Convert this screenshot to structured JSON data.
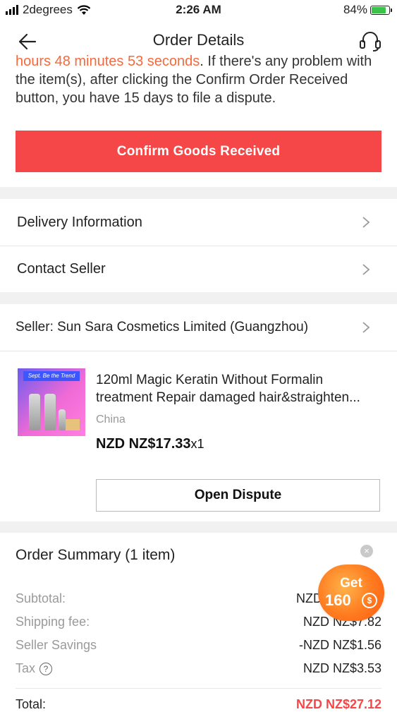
{
  "status_bar": {
    "carrier": "2degrees",
    "time": "2:26 AM",
    "battery": "84%",
    "battery_level": 0.84
  },
  "header": {
    "title": "Order Details",
    "back_icon": "back-arrow-icon",
    "support_icon": "headset-icon"
  },
  "notice": {
    "countdown_text": "hours 48 minutes 53 seconds",
    "rest_text": ". If there's any problem with the item(s), after clicking the Confirm Order Received button, you have 15 days to file a dispute."
  },
  "confirm_button": "Confirm Goods Received",
  "links": {
    "delivery": "Delivery Information",
    "contact": "Contact Seller"
  },
  "seller": {
    "label": "Seller: Sun Sara Cosmetics Limited (Guangzhou)"
  },
  "product": {
    "image_banner": "Sept. Be the Trend",
    "title": "120ml Magic Keratin Without Formalin treatment Repair damaged hair&straighten...",
    "origin": "China",
    "price": "NZD NZ$17.33",
    "quantity": "x1"
  },
  "dispute_button": "Open Dispute",
  "summary": {
    "title": "Order Summary (1 item)",
    "close_icon": "close-icon",
    "rows": [
      {
        "label": "Subtotal:",
        "value": "NZD NZ$17.33"
      },
      {
        "label": "Shipping fee:",
        "value": "NZD NZ$7.82"
      },
      {
        "label": "Seller Savings",
        "value": "-NZD NZ$1.56"
      },
      {
        "label": "Tax",
        "value": "NZD NZ$3.53"
      }
    ],
    "total_label": "Total:",
    "total_value": "NZD NZ$27.12"
  },
  "promo": {
    "get": "Get",
    "amount": "160",
    "coin_symbol": "$"
  },
  "colors": {
    "accent_red": "#f54747",
    "countdown_orange": "#f7683a",
    "promo_orange": "#ff7a1f"
  }
}
